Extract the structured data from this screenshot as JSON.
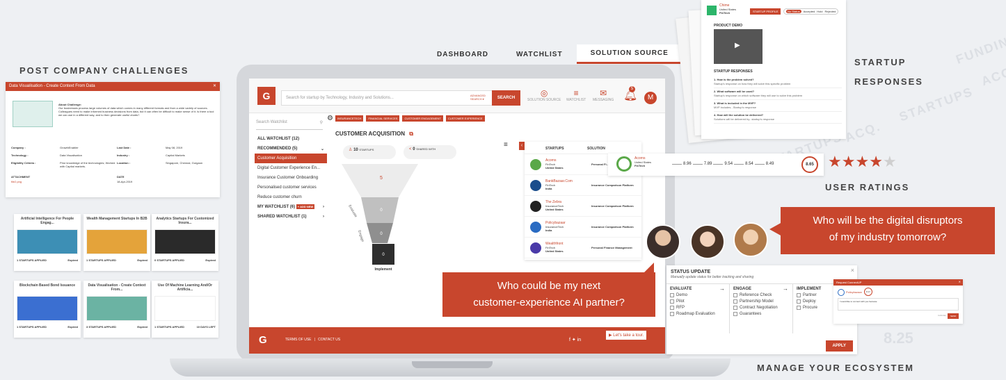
{
  "bg_words": [
    "FUNDING",
    "STARTUPS",
    "ACQ.",
    "STARTUPS",
    "ACQ"
  ],
  "labels": {
    "post_challenges": "POST COMPANY CHALLENGES",
    "startup_responses_1": "STARTUP",
    "startup_responses_2": "RESPONSES",
    "user_ratings": "USER RATINGS",
    "manage": "MANAGE YOUR ECOSYSTEM"
  },
  "challenge_modal": {
    "title": "Data Visualisation - Create Context From Data",
    "about_heading": "About Challenge:",
    "about_text": "Our businesses process large volumes of data which comes in many different formats and from a wide variety of sources. Colleagues need to make informed business decisions from data, but it can often be difficult to make sense of it. Is there a tool we can use in a different way, and to then generate useful charts?",
    "rows": [
      {
        "k1": "Company :",
        "v1": "GrowthEnabler",
        "k2": "Last Date :",
        "v2": "May 08, 2019"
      },
      {
        "k1": "Technology :",
        "v1": "Data Visualisation",
        "k2": "Industry :",
        "v2": "Capital Markets"
      },
      {
        "k1": "Eligibility Criteria :",
        "v1": "Prior knowledge of the technologies; Worked with Capital markets.",
        "k2": "Location :",
        "v2": "Singapore, Chennai, Gurgaon"
      }
    ],
    "attachment_label": "ATTACHMENT",
    "attachment": "file2.png",
    "date_label": "DATE",
    "date": "18-Apr-2019"
  },
  "mini_cards": [
    {
      "title": "Artificial Intelligence For People Engag...",
      "applied": "1 STARTUPS APPLIED",
      "status": "Expired",
      "color": "#3d8fb5"
    },
    {
      "title": "Wealth Management Startups In B2B",
      "applied": "1 STARTUPS APPLIED",
      "status": "Expired",
      "color": "#e4a33a"
    },
    {
      "title": "Analytics Startups For Customized Insura...",
      "applied": "0 STARTUPS APPLIED",
      "status": "Expired",
      "color": "#2a2a2a"
    },
    {
      "title": "Blockchain Based Bond Issuance",
      "applied": "1 STARTUPS APPLIED",
      "status": "Expired",
      "color": "#3b6fd1"
    },
    {
      "title": "Data Visualisation - Create Context From...",
      "applied": "3 STARTUPS APPLIED",
      "status": "Expired",
      "color": "#6bb3a3"
    },
    {
      "title": "Use Of Machine Learning And/Or Artificia...",
      "applied": "1 STARTUPS APPLIED",
      "status": "10 DAYS LEFT",
      "color": "#ffffff"
    }
  ],
  "tabs": [
    "DASHBOARD",
    "WATCHLIST",
    "SOLUTION SOURCE"
  ],
  "app": {
    "logo": "G",
    "search_placeholder": "Search for startup by Technology, Industry and Solutions...",
    "advanced": "ADVANCED SEARCH ▾",
    "search_btn": "SEARCH",
    "nav": [
      "SOLUTION SOURCE",
      "WATCHLIST",
      "MESSAGING"
    ],
    "notif_count": "5",
    "user_initial": "M",
    "search_watchlist": "Search Watchlist",
    "all_watchlist": "ALL WATCHLIST (12)",
    "recommended": "RECOMMENDED (5)",
    "sidebar_items": [
      "Customer Acquisition",
      "Digital Customer Experience En...",
      "Insurance Customer Onboarding",
      "Personalised customer services",
      "Reduce customer churn"
    ],
    "my_watchlist": "MY WATCHLIST (6)",
    "add_new": "+ ADD NEW",
    "shared_watchlist": "SHARED WATCHLIST (1)",
    "tags": [
      "INSURANCETECH",
      "FINANCIAL SERVICES",
      "CUSTOMER ENGAGEMENT",
      "CUSTOMER EXPERIENCE"
    ],
    "section_title": "CUSTOMER ACQUISITION",
    "startups_count": "10",
    "startups_lbl": "STARTUPS",
    "shared_count": "0",
    "shared_lbl": "SHARED WITH",
    "funnel_values": [
      "5",
      "0",
      "0",
      "0"
    ],
    "funnel_labels": [
      "Evaluate",
      "Engage",
      "Implement"
    ],
    "table_headers": [
      "STARTUPS",
      "SOLUTION"
    ],
    "table_rows": [
      {
        "name": "Acorns",
        "cat": "FinTech",
        "country": "United States",
        "solution": "Personal Fi... Manageme...",
        "color": "#5aa848"
      },
      {
        "name": "BankBazaar.Com",
        "cat": "FinTech",
        "country": "India",
        "solution": "Insurance Comparison Platform",
        "color": "#1b4d8c"
      },
      {
        "name": "The Zebra",
        "cat": "InsuranceTech",
        "country": "United States",
        "solution": "Insurance Comparison Platform",
        "color": "#222222"
      },
      {
        "name": "Policybazaar",
        "cat": "InsuranceTech",
        "country": "India",
        "solution": "Insurance Comparison Platform",
        "color": "#2a6bc2"
      },
      {
        "name": "Wealthfront",
        "cat": "FinTech",
        "country": "United States",
        "solution": "Personal Finance Management",
        "color": "#4a3aa8"
      }
    ],
    "footer_links": "TERMS OF USE   |   CONTACT US",
    "tour": "Let's take a tour."
  },
  "rating_strip": {
    "name": "Acorns",
    "country": "United States",
    "cat": "FinTech",
    "scores": [
      "8.96",
      "7.89",
      "9.54",
      "8.54",
      "8.49"
    ],
    "final": "8.65",
    "stars": 4
  },
  "response_card": {
    "company": "Chime",
    "country": "United States",
    "cat": "FinTech",
    "profile_btn": "STARTUP PROFILE",
    "statuses": [
      "No Status",
      "Accepted",
      "Hold",
      "Rejected"
    ],
    "demo": "PRODUCT DEMO",
    "responses_title": "STARTUP RESPONSES",
    "qa": [
      {
        "q": "1. How is the problem solved?",
        "a": "Startup's response on how they will solve this specific problem"
      },
      {
        "q": "2. What software will be used?",
        "a": "Startup's response on which software they will use to solve this problem"
      },
      {
        "q": "3. What is included in the MVP?",
        "a": "MVP includes...Startup's response"
      },
      {
        "q": "4. How will the solution be delivered?",
        "a": "Solutions will be delivered by...startup's response"
      }
    ]
  },
  "speech": {
    "right": [
      "Who will be the digital disruptors",
      "of my industry tomorrow?"
    ],
    "center": [
      "Who could be my next",
      "customer-experience AI partner?"
    ]
  },
  "status_update": {
    "title": "STATUS UPDATE",
    "subtitle": "Manually update status for better tracking and sharing",
    "cols": [
      {
        "head": "EVALUATE",
        "items": [
          "Demo",
          "Pilot",
          "RFP",
          "Roadmap Evaluation"
        ]
      },
      {
        "head": "ENGAGE",
        "items": [
          "Reference Check",
          "Partnership Model",
          "Contract Negotiation",
          "Guarantees"
        ]
      },
      {
        "head": "IMPLEMENT",
        "items": [
          "Partner",
          "Deploy",
          "Procure"
        ]
      }
    ],
    "apply": "APPLY"
  },
  "request_modal": {
    "title": "Request ConnectUP",
    "name": "Policybazaar",
    "score": "8.17",
    "message": "I would like to connect with you because",
    "send": "SEND",
    "cancel": "CANCEL"
  },
  "deco_score": "8.25"
}
